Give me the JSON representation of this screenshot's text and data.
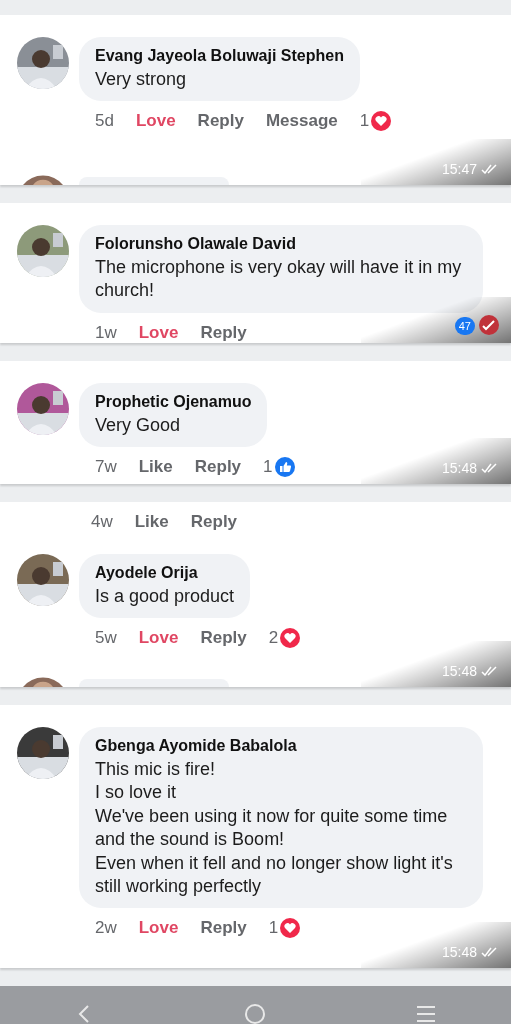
{
  "messages": [
    {
      "comments": [
        {
          "name": "Evang Jayeola Boluwaji Stephen",
          "text": "Very strong",
          "time": "5d",
          "reaction_label": "Love",
          "reacted": true,
          "reply": "Reply",
          "message": "Message",
          "reaction_count": "1",
          "kind": "love"
        }
      ],
      "peek": true,
      "timestamp": "15:47"
    },
    {
      "comments": [
        {
          "name": "Folorunsho Olawale David",
          "text": "The microphone is very okay will have it in my church!",
          "time": "1w",
          "reaction_label": "Love",
          "reacted": true,
          "reply": "Reply"
        }
      ],
      "peek": false,
      "badge": "47"
    },
    {
      "comments": [
        {
          "name": "Prophetic Ojenamuo",
          "text": "Very Good",
          "time": "7w",
          "reaction_label": "Like",
          "reacted": false,
          "reply": "Reply",
          "reaction_count": "1",
          "kind": "like"
        }
      ],
      "peek": false,
      "timestamp": "15:48"
    },
    {
      "top_actions": {
        "time": "4w",
        "reaction_label": "Like",
        "reacted": false,
        "reply": "Reply"
      },
      "comments": [
        {
          "name": "Ayodele Orija",
          "text": "Is a good product",
          "time": "5w",
          "reaction_label": "Love",
          "reacted": true,
          "reply": "Reply",
          "reaction_count": "2",
          "kind": "love"
        }
      ],
      "peek": true,
      "timestamp": "15:48"
    },
    {
      "comments": [
        {
          "name": "Gbenga Ayomide Babalola",
          "text": "This mic is fire!\nI so love it\nWe've been using it now for quite some time and the sound is Boom!\nEven when it fell and no longer show light it's still working perfectly",
          "time": "2w",
          "reaction_label": "Love",
          "reacted": true,
          "reply": "Reply",
          "reaction_count": "1",
          "kind": "love"
        }
      ],
      "peek": false,
      "timestamp": "15:48"
    }
  ]
}
